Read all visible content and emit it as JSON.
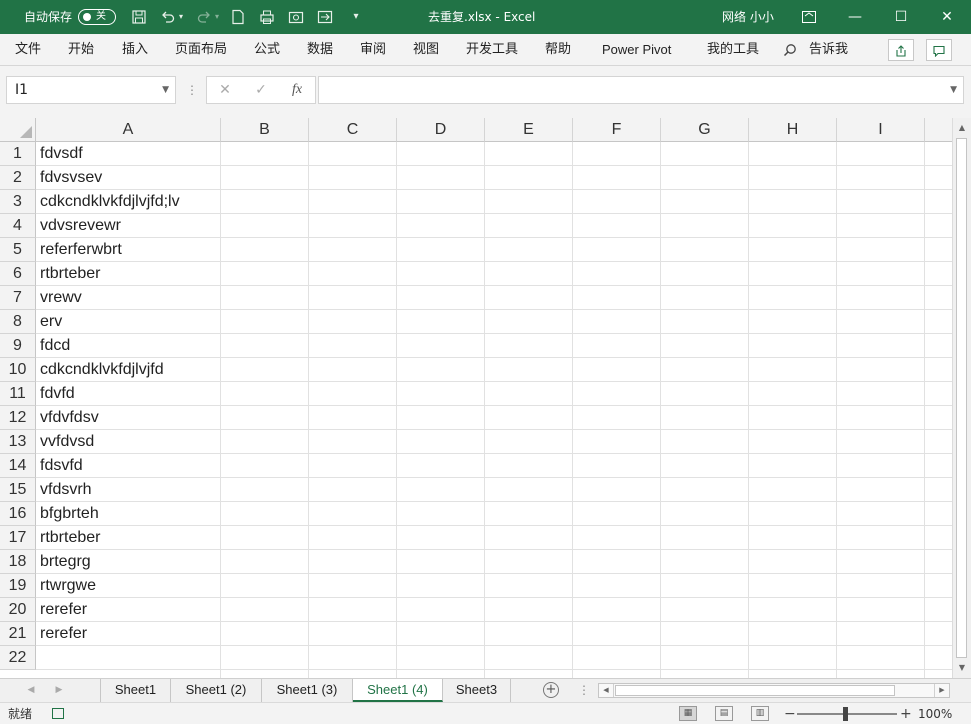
{
  "titlebar": {
    "autosave_label": "自动保存",
    "autosave_state": "关",
    "title": "去重复.xlsx  -  Excel",
    "user": "网络 小小",
    "icons": [
      "save-icon",
      "undo-icon",
      "redo-icon",
      "new-file-icon",
      "print-preview-icon",
      "screenshot-icon",
      "customize-dropdown-icon"
    ]
  },
  "ribbon": {
    "tabs": [
      "文件",
      "开始",
      "插入",
      "页面布局",
      "公式",
      "数据",
      "审阅",
      "视图",
      "开发工具",
      "帮助",
      "Power Pivot",
      "我的工具"
    ],
    "tell_me": "告诉我"
  },
  "formula_bar": {
    "name_box": "I1",
    "formula": "",
    "fx": "fx"
  },
  "grid": {
    "columns": [
      "A",
      "B",
      "C",
      "D",
      "E",
      "F",
      "G",
      "H",
      "I"
    ],
    "rows": [
      "1",
      "2",
      "3",
      "4",
      "5",
      "6",
      "7",
      "8",
      "9",
      "10",
      "11",
      "12",
      "13",
      "14",
      "15",
      "16",
      "17",
      "18",
      "19",
      "20",
      "21",
      "22"
    ],
    "column_a": [
      "fdvsdf",
      "fdvsvsev",
      "cdkcndklvkfdjlvjfd;lv",
      "vdvsrevewr",
      "referferwbrt",
      "rtbrteber",
      "vrewv",
      "erv",
      "fdcd",
      "cdkcndklvkfdjlvjfd",
      "fdvfd",
      "vfdvfdsv",
      "vvfdvsd",
      "fdsvfd",
      "vfdsvrh",
      "bfgbrteh",
      "rtbrteber",
      "brtegrg",
      "rtwrgwe",
      "rerefer",
      "rerefer",
      ""
    ]
  },
  "sheets": {
    "tabs": [
      "Sheet1",
      "Sheet1 (2)",
      "Sheet1 (3)",
      "Sheet1 (4)",
      "Sheet3"
    ],
    "active": "Sheet1 (4)"
  },
  "statusbar": {
    "ready": "就绪",
    "zoom": "100%",
    "zoom_minus": "−",
    "zoom_plus": "+"
  },
  "colors": {
    "accent": "#217346",
    "gridline": "#e1e1e1",
    "header_bg": "#f3f3f3"
  }
}
